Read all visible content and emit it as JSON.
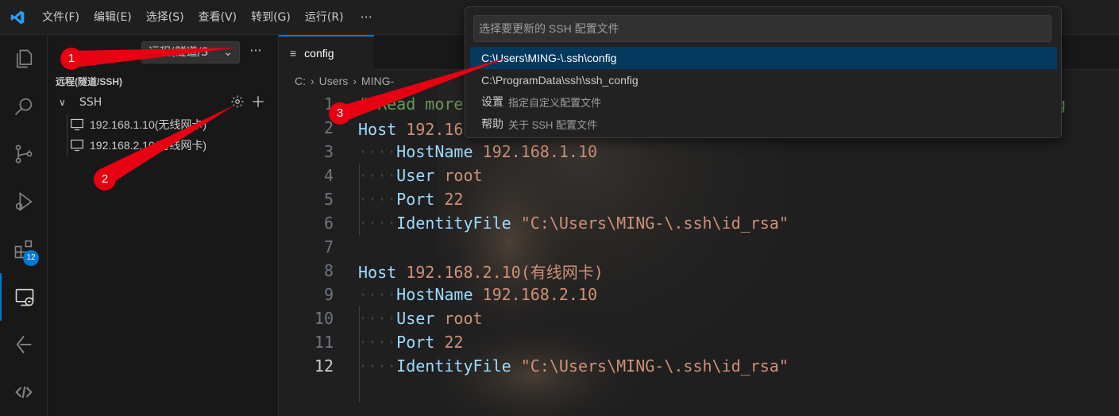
{
  "app": {
    "logo": "vscode-logo"
  },
  "menu": [
    {
      "label": "文件(F)"
    },
    {
      "label": "编辑(E)"
    },
    {
      "label": "选择(S)"
    },
    {
      "label": "查看(V)"
    },
    {
      "label": "转到(G)"
    },
    {
      "label": "运行(R)"
    }
  ],
  "menu_more": "···",
  "activity": [
    {
      "icon": "explorer-icon"
    },
    {
      "icon": "search-icon"
    },
    {
      "icon": "source-control-icon"
    },
    {
      "icon": "run-debug-icon"
    },
    {
      "icon": "extensions-icon",
      "badge": "12"
    },
    {
      "icon": "remote-explorer-icon",
      "active": true
    },
    {
      "icon": "git-lens-icon"
    },
    {
      "icon": "remote-icon"
    }
  ],
  "sidebar": {
    "remote_select": "远程(隧道/S",
    "more": "···",
    "section_title": "远程(隧道/SSH)",
    "group": {
      "label": "SSH"
    },
    "hosts": [
      {
        "label": "192.168.1.10(无线网卡)"
      },
      {
        "label": "192.168.2.10(有线网卡)"
      }
    ]
  },
  "editor": {
    "tab": {
      "icon": "≡",
      "label": "config"
    },
    "breadcrumb": [
      "C:",
      "Users",
      "MING-"
    ],
    "lines": [
      {
        "n": "1",
        "parts": [
          {
            "t": "# Read more about SSH config files: https://linux.die.net/man/5/ssh_config",
            "c": "cmt"
          }
        ]
      },
      {
        "n": "2",
        "parts": [
          {
            "t": "Host ",
            "c": "kw"
          },
          {
            "t": "192.168.1.10(无线网卡)",
            "c": "val"
          }
        ]
      },
      {
        "n": "3",
        "parts": [
          {
            "t": "····",
            "c": "indent"
          },
          {
            "t": "HostName ",
            "c": "kw"
          },
          {
            "t": "192.168.1.10",
            "c": "val"
          }
        ]
      },
      {
        "n": "4",
        "parts": [
          {
            "t": "····",
            "c": "indent"
          },
          {
            "t": "User ",
            "c": "kw"
          },
          {
            "t": "root",
            "c": "val"
          }
        ]
      },
      {
        "n": "5",
        "parts": [
          {
            "t": "····",
            "c": "indent"
          },
          {
            "t": "Port ",
            "c": "kw"
          },
          {
            "t": "22",
            "c": "val"
          }
        ]
      },
      {
        "n": "6",
        "parts": [
          {
            "t": "····",
            "c": "indent"
          },
          {
            "t": "IdentityFile ",
            "c": "kw"
          },
          {
            "t": "\"C:\\Users\\MING-\\.ssh\\id_rsa\"",
            "c": "val"
          }
        ]
      },
      {
        "n": "7",
        "parts": []
      },
      {
        "n": "8",
        "parts": [
          {
            "t": "Host ",
            "c": "kw"
          },
          {
            "t": "192.168.2.10(有线网卡)",
            "c": "val"
          }
        ]
      },
      {
        "n": "9",
        "parts": [
          {
            "t": "····",
            "c": "indent"
          },
          {
            "t": "HostName ",
            "c": "kw"
          },
          {
            "t": "192.168.2.10",
            "c": "val"
          }
        ]
      },
      {
        "n": "10",
        "parts": [
          {
            "t": "····",
            "c": "indent"
          },
          {
            "t": "User ",
            "c": "kw"
          },
          {
            "t": "root",
            "c": "val"
          }
        ]
      },
      {
        "n": "11",
        "parts": [
          {
            "t": "····",
            "c": "indent"
          },
          {
            "t": "Port ",
            "c": "kw"
          },
          {
            "t": "22",
            "c": "val"
          }
        ]
      },
      {
        "n": "12",
        "active": true,
        "parts": [
          {
            "t": "····",
            "c": "indent"
          },
          {
            "t": "IdentityFile ",
            "c": "kw"
          },
          {
            "t": "\"C:\\Users\\MING-\\.ssh\\id_rsa\"",
            "c": "val"
          }
        ]
      }
    ]
  },
  "quickpick": {
    "placeholder": "选择要更新的 SSH 配置文件",
    "items": [
      {
        "label": "C:\\Users\\MING-\\.ssh\\config",
        "desc": ""
      },
      {
        "label": "C:\\ProgramData\\ssh\\ssh_config",
        "desc": ""
      },
      {
        "label": "设置",
        "desc": "指定自定义配置文件"
      },
      {
        "label": "帮助",
        "desc": "关于 SSH 配置文件"
      }
    ]
  },
  "annotations": [
    {
      "label": "1"
    },
    {
      "label": "2"
    },
    {
      "label": "3"
    }
  ],
  "colors": {
    "accent": "#0078d4",
    "annotation": "#e60012",
    "keyword": "#9cdcfe",
    "string": "#ce9178",
    "comment": "#6a9955"
  }
}
